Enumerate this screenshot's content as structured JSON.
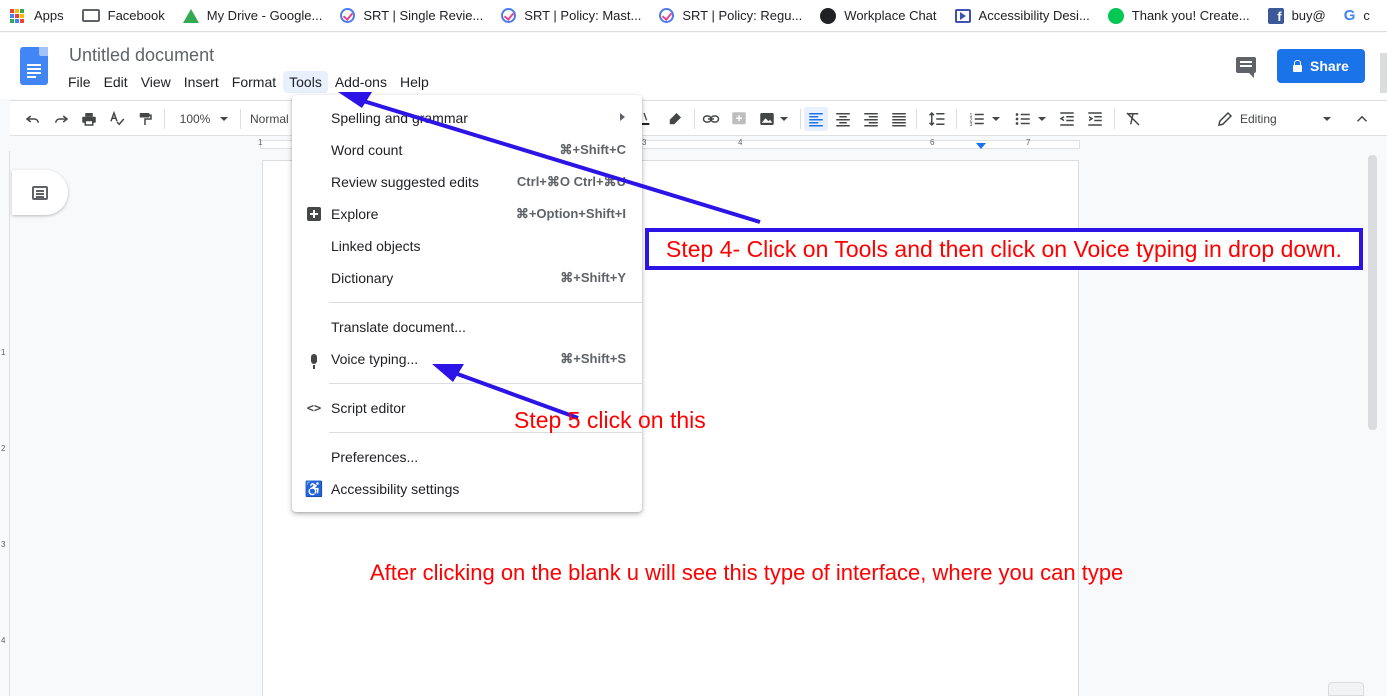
{
  "bookmarks": [
    {
      "label": "Apps",
      "icon": "apps-grid-icon"
    },
    {
      "label": "Facebook",
      "icon": "folder-icon"
    },
    {
      "label": "My Drive - Google...",
      "icon": "google-drive-icon"
    },
    {
      "label": "SRT | Single Revie...",
      "icon": "srt-icon"
    },
    {
      "label": "SRT | Policy: Mast...",
      "icon": "srt-icon"
    },
    {
      "label": "SRT | Policy: Regu...",
      "icon": "srt-icon"
    },
    {
      "label": "Workplace Chat",
      "icon": "workplace-icon"
    },
    {
      "label": "Accessibility Desi...",
      "icon": "video-icon"
    },
    {
      "label": "Thank you! Create...",
      "icon": "check-circle-icon"
    },
    {
      "label": "buy@",
      "icon": "facebook-icon"
    },
    {
      "label": "c",
      "icon": "google-icon"
    }
  ],
  "doc": {
    "title": "Untitled document",
    "share_label": "Share"
  },
  "menubar": [
    "File",
    "Edit",
    "View",
    "Insert",
    "Format",
    "Tools",
    "Add-ons",
    "Help"
  ],
  "toolbar": {
    "zoom": "100%",
    "style": "Normal",
    "mode": "Editing"
  },
  "ruler": {
    "numbers": [
      "1",
      "3",
      "4",
      "6",
      "7"
    ]
  },
  "vruler": {
    "numbers": [
      "1",
      "2",
      "3",
      "4"
    ]
  },
  "tools_menu": {
    "items": [
      {
        "label": "Spelling and grammar",
        "shortcut": "",
        "submenu": true,
        "icon": ""
      },
      {
        "label": "Word count",
        "shortcut": "⌘+Shift+C",
        "icon": ""
      },
      {
        "label": "Review suggested edits",
        "shortcut": "Ctrl+⌘O Ctrl+⌘U",
        "icon": ""
      },
      {
        "label": "Explore",
        "shortcut": "⌘+Option+Shift+I",
        "icon": "explore-icon"
      },
      {
        "label": "Linked objects",
        "shortcut": "",
        "icon": ""
      },
      {
        "label": "Dictionary",
        "shortcut": "⌘+Shift+Y",
        "icon": ""
      },
      {
        "label": "Translate document...",
        "shortcut": "",
        "icon": ""
      },
      {
        "label": "Voice typing...",
        "shortcut": "⌘+Shift+S",
        "icon": "microphone-icon"
      },
      {
        "label": "Script editor",
        "shortcut": "",
        "icon": "code-icon"
      },
      {
        "label": "Preferences...",
        "shortcut": "",
        "icon": ""
      },
      {
        "label": "Accessibility settings",
        "shortcut": "",
        "icon": "accessibility-icon"
      }
    ]
  },
  "annotations": {
    "step4": "Step 4- Click on Tools and then click on Voice typing in drop down.",
    "step5": "Step 5 click on this",
    "after": "After clicking on the blank u will see this type of interface, where you can type"
  },
  "colors": {
    "accent": "#1a73e8",
    "annotation_text": "#ff0000",
    "annotation_arrow": "#2d14e6"
  }
}
